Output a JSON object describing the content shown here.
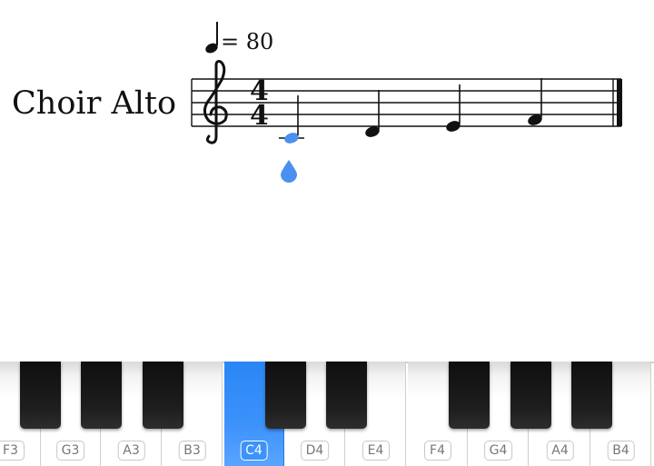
{
  "score": {
    "part_name": "Choir Alto",
    "tempo_value": "= 80",
    "time_signature": {
      "numerator": "4",
      "denominator": "4"
    },
    "clef": "treble",
    "notes": [
      {
        "pitch": "C4",
        "duration": "quarter",
        "selected": true
      },
      {
        "pitch": "D4",
        "duration": "quarter",
        "selected": false
      },
      {
        "pitch": "E4",
        "duration": "quarter",
        "selected": false
      },
      {
        "pitch": "F4",
        "duration": "quarter",
        "selected": false
      }
    ],
    "accent_color": "#4a90f0"
  },
  "keyboard": {
    "active_key": "C4",
    "active_color": "#2a86f5",
    "white_keys": [
      "F3",
      "G3",
      "A3",
      "B3",
      "C4",
      "D4",
      "E4",
      "F4",
      "G4",
      "A4",
      "B4"
    ]
  }
}
